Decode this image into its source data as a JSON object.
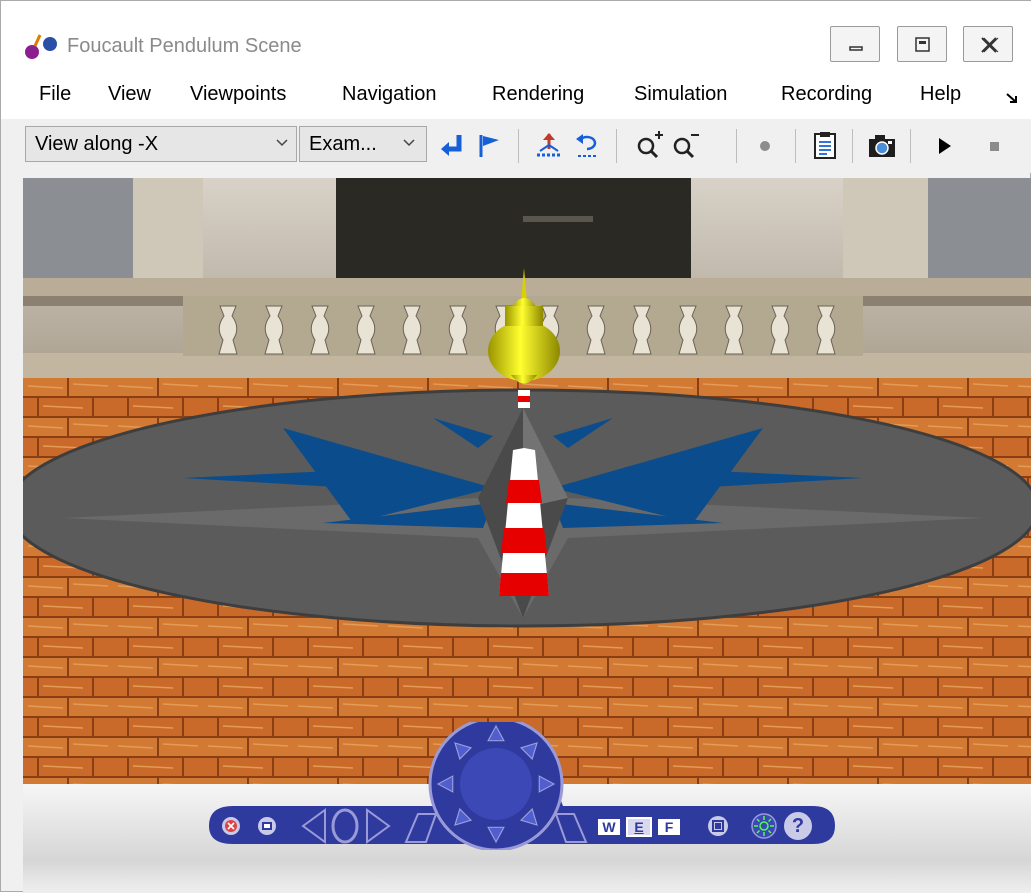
{
  "window": {
    "title": "Foucault Pendulum Scene"
  },
  "window_buttons": [
    {
      "name": "minimize"
    },
    {
      "name": "restore"
    },
    {
      "name": "close"
    }
  ],
  "menu": {
    "items": [
      "File",
      "View",
      "Viewpoints",
      "Navigation",
      "Rendering",
      "Simulation",
      "Recording",
      "Help"
    ],
    "overflow_icon": "chevron-double-icon"
  },
  "toolbar": {
    "viewpoint_value": "View along -X",
    "navigation_mode_value": "Exam...",
    "icons": [
      "return-to-viewpoint-icon",
      "create-viewpoint-icon",
      "straighten-up-icon",
      "undo-move-icon",
      "zoom-in-icon",
      "zoom-out-icon",
      "record-icon",
      "snapshot-document-icon",
      "camera-icon",
      "play-icon",
      "stop-icon"
    ]
  },
  "navigation_panel": {
    "mode_buttons": [
      "W",
      "E",
      "F"
    ],
    "help_label": "?",
    "selected_mode": "E",
    "accent_color": "#2e3a9e",
    "icons": [
      "close-panel-icon",
      "panel-options-icon",
      "rotate-left-icon",
      "rotate-right-icon",
      "joystick-icon",
      "wireframe-mode-icon",
      "examine-mode-icon",
      "fly-mode-icon",
      "viewpoints-icon",
      "headlight-icon",
      "help-icon"
    ]
  },
  "scene": {
    "sky_color": "#c9c4bc",
    "floor_color": "#c9692a",
    "disk_color": "#575757",
    "star_color": "#0b4c8d",
    "bob_color": "#e6e000",
    "cone_colors": [
      "#ffffff",
      "#e60000"
    ]
  }
}
